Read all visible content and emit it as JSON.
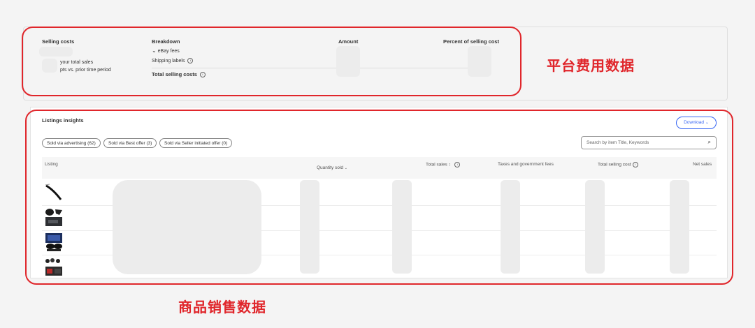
{
  "selling_costs": {
    "title": "Selling costs",
    "line1": "your total sales",
    "line2": "pts  vs. prior time period",
    "breakdown_header": "Breakdown",
    "amount_header": "Amount",
    "percent_header": "Percent of selling cost",
    "ebay_fees": "eBay fees",
    "shipping_labels": "Shipping labels",
    "total_selling_costs": "Total selling costs"
  },
  "annotations": {
    "platform_fees": "平台费用数据",
    "product_sales": "商品销售数据"
  },
  "listings": {
    "title": "Listings insights",
    "download_label": "Download",
    "filters": [
      "Sold via advertising (62)",
      "Sold via Best offer (3)",
      "Sold via Seller initiated offer (0)"
    ],
    "search_placeholder": "Search by item Title, Keywords",
    "columns": {
      "listing": "Listing",
      "quantity_sold": "Quantity sold",
      "total_sales": "Total sales",
      "taxes": "Taxes and government fees",
      "total_selling_cost": "Total selling cost",
      "net_sales": "Net sales"
    },
    "rows": [
      {
        "thumb": "wiper-blade-image"
      },
      {
        "thumb": "black-parts-image"
      },
      {
        "thumb": "boxed-set-image"
      },
      {
        "thumb": "parts-kit-image"
      }
    ]
  },
  "colors": {
    "annotation_red": "#e0262b",
    "accent_blue": "#3665f3"
  }
}
